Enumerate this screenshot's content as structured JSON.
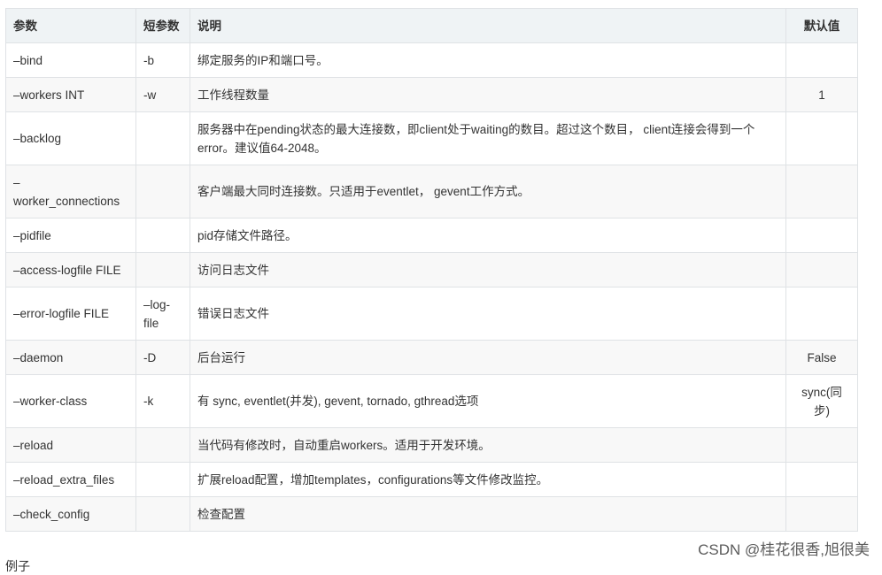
{
  "table": {
    "headers": {
      "param": "参数",
      "short": "短参数",
      "desc": "说明",
      "default": "默认值"
    },
    "rows": [
      {
        "param": "–bind",
        "short": "-b",
        "desc": "绑定服务的IP和端口号。",
        "default": ""
      },
      {
        "param": "–workers INT",
        "short": "-w",
        "desc": "工作线程数量",
        "default": "1"
      },
      {
        "param": "–backlog",
        "short": "",
        "desc": "服务器中在pending状态的最大连接数，即client处于waiting的数目。超过这个数目， client连接会得到一个error。建议值64-2048。",
        "default": ""
      },
      {
        "param": "–\nworker_connections",
        "short": "",
        "desc": "客户端最大同时连接数。只适用于eventlet， gevent工作方式。",
        "default": ""
      },
      {
        "param": "–pidfile",
        "short": "",
        "desc": "pid存储文件路径。",
        "default": ""
      },
      {
        "param": "–access-logfile FILE",
        "short": "",
        "desc": "访问日志文件",
        "default": ""
      },
      {
        "param": "–error-logfile FILE",
        "short": "–log-\nfile",
        "desc": "错误日志文件",
        "default": ""
      },
      {
        "param": "–daemon",
        "short": "-D",
        "desc": "后台运行",
        "default": "False"
      },
      {
        "param": "–worker-class",
        "short": "-k",
        "desc": "有 sync, eventlet(并发), gevent, tornado, gthread选项",
        "default": "sync(同\n步)"
      },
      {
        "param": "–reload",
        "short": "",
        "desc": "当代码有修改时，自动重启workers。适用于开发环境。",
        "default": ""
      },
      {
        "param": "–reload_extra_files",
        "short": "",
        "desc": "扩展reload配置，增加templates，configurations等文件修改监控。",
        "default": ""
      },
      {
        "param": "–check_config",
        "short": "",
        "desc": "检查配置",
        "default": ""
      }
    ]
  },
  "watermark": "CSDN @桂花很香,旭很美",
  "next_text": "例子"
}
